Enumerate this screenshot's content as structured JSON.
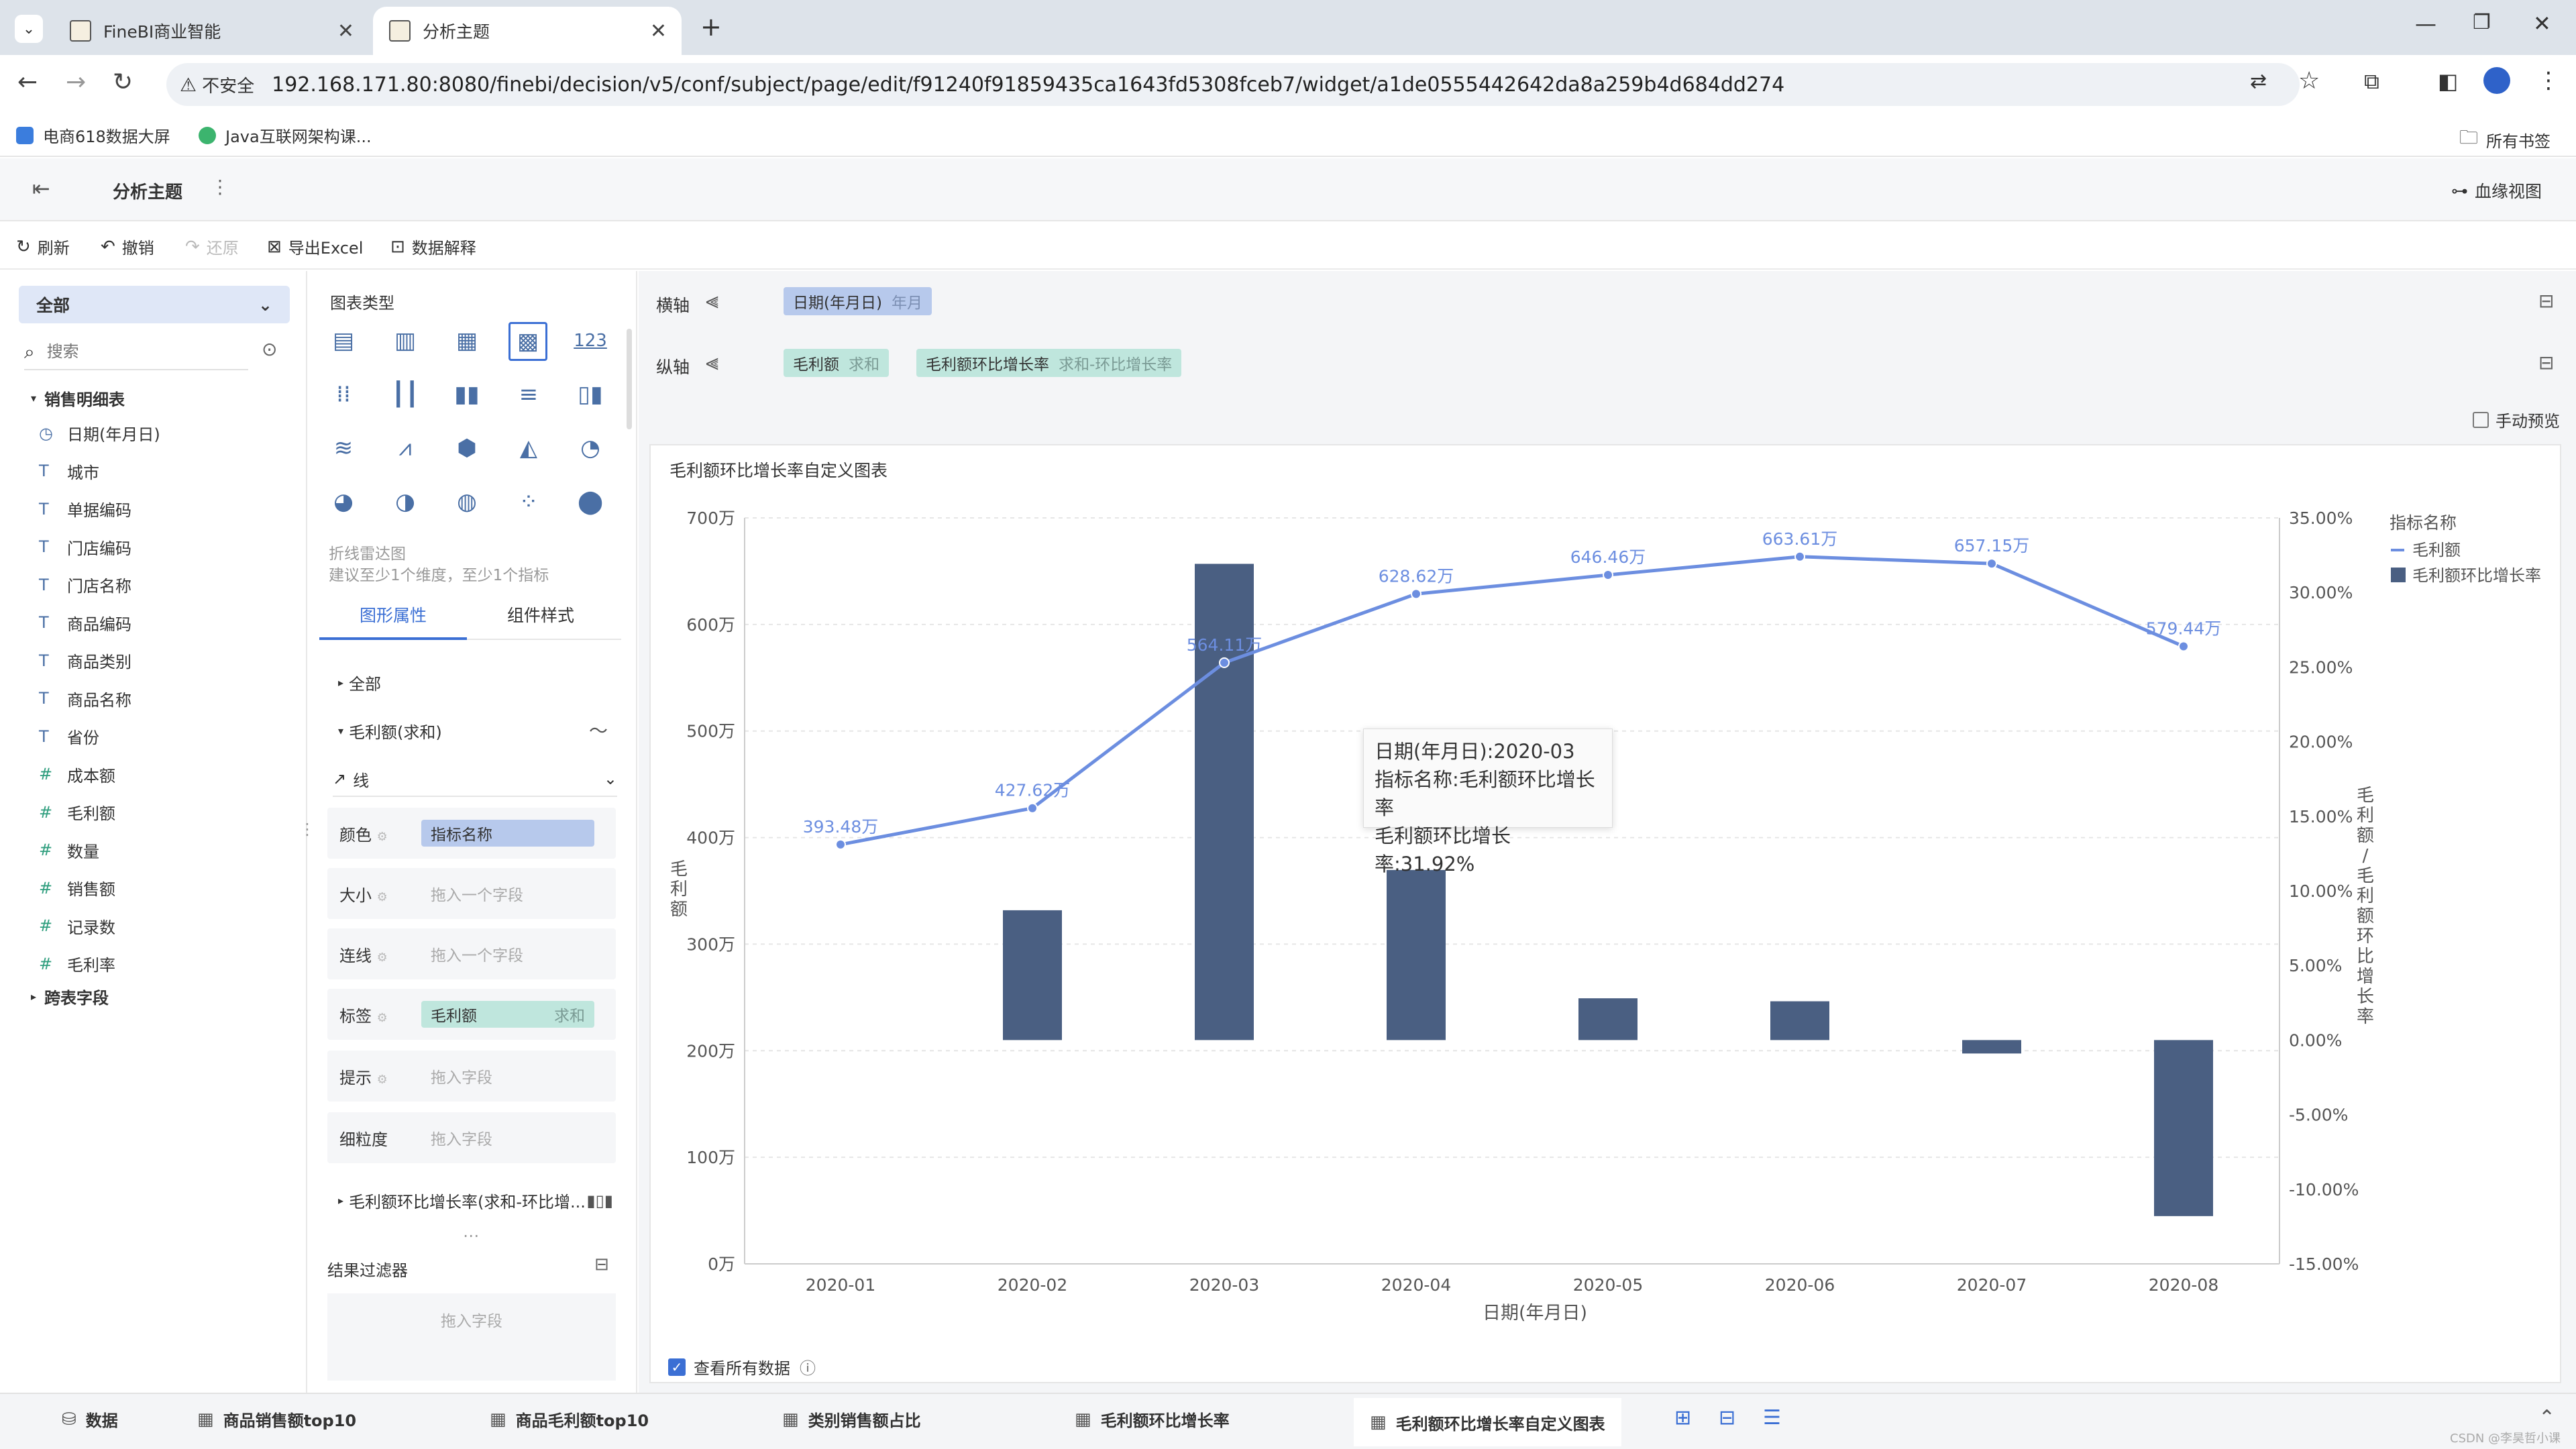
{
  "browser": {
    "tabs": [
      {
        "title": "FineBI商业智能"
      },
      {
        "title": "分析主题"
      }
    ],
    "security_label": "不安全",
    "url": "192.168.171.80:8080/finebi/decision/v5/conf/subject/page/edit/f91240f91859435ca1643fd5308fceb7/widget/a1de0555442642da8a259b4d684dd274",
    "bookmarks": [
      "电商618数据大屏",
      "Java互联网架构课..."
    ],
    "all_bookmarks": "所有书签"
  },
  "app": {
    "title": "分析主题",
    "lineage_view": "血缘视图"
  },
  "toolbar": {
    "refresh": "刷新",
    "undo": "撤销",
    "redo": "还原",
    "export_excel": "导出Excel",
    "data_explain": "数据解释"
  },
  "left": {
    "dropdown": "全部",
    "search_placeholder": "搜索",
    "table_name": "销售明细表",
    "fields": [
      {
        "name": "日期(年月日)",
        "type": "date"
      },
      {
        "name": "城市",
        "type": "text"
      },
      {
        "name": "单据编码",
        "type": "text"
      },
      {
        "name": "门店编码",
        "type": "text"
      },
      {
        "name": "门店名称",
        "type": "text"
      },
      {
        "name": "商品编码",
        "type": "text"
      },
      {
        "name": "商品类别",
        "type": "text"
      },
      {
        "name": "商品名称",
        "type": "text"
      },
      {
        "name": "省份",
        "type": "text"
      },
      {
        "name": "成本额",
        "type": "num"
      },
      {
        "name": "毛利额",
        "type": "num"
      },
      {
        "name": "数量",
        "type": "num"
      },
      {
        "name": "销售额",
        "type": "num"
      },
      {
        "name": "记录数",
        "type": "num"
      },
      {
        "name": "毛利率",
        "type": "num"
      }
    ],
    "cross_table": "跨表字段"
  },
  "middle": {
    "chart_type_label": "图表类型",
    "numeric_icon_label": "123",
    "hint_title": "折线雷达图",
    "hint_desc": "建议至少1个维度，至少1个指标",
    "tabs": [
      "图形属性",
      "组件样式"
    ],
    "all_label": "全部",
    "series1": "毛利额(求和)",
    "line_label": "线",
    "props": {
      "color": {
        "label": "颜色",
        "value": "指标名称"
      },
      "size": {
        "label": "大小",
        "placeholder": "拖入一个字段"
      },
      "connect": {
        "label": "连线",
        "placeholder": "拖入一个字段"
      },
      "label": {
        "label": "标签",
        "value": "毛利额",
        "agg": "求和"
      },
      "tip": {
        "label": "提示",
        "placeholder": "拖入字段"
      },
      "granularity": {
        "label": "细粒度",
        "placeholder": "拖入字段"
      }
    },
    "series2": "毛利额环比增长率(求和-环比增...",
    "filter_title": "结果过滤器",
    "filter_placeholder": "拖入字段"
  },
  "axes_config": {
    "x_label": "横轴",
    "x_field": "日期(年月日)",
    "x_field_sub": "年月",
    "y_label": "纵轴",
    "y_field1": "毛利额",
    "y_field1_sub": "求和",
    "y_field2": "毛利额环比增长率",
    "y_field2_sub": "求和-环比增长率",
    "manual_preview": "手动预览"
  },
  "chart_data": {
    "type": "bar",
    "title": "毛利额环比增长率自定义图表",
    "xlabel": "日期(年月日)",
    "ylabel": "毛利额",
    "y2label": "毛利额/毛利额环比增长率",
    "categories": [
      "2020-01",
      "2020-02",
      "2020-03",
      "2020-04",
      "2020-05",
      "2020-06",
      "2020-07",
      "2020-08"
    ],
    "ylim": [
      0,
      7000000
    ],
    "y_ticks": [
      "0万",
      "100万",
      "200万",
      "300万",
      "400万",
      "500万",
      "600万",
      "700万"
    ],
    "y2lim": [
      -15,
      35
    ],
    "y2_ticks": [
      "-15.00%",
      "-10.00%",
      "-5.00%",
      "0.00%",
      "5.00%",
      "10.00%",
      "15.00%",
      "20.00%",
      "25.00%",
      "30.00%",
      "35.00%"
    ],
    "legend_title": "指标名称",
    "series": [
      {
        "name": "毛利额",
        "kind": "line",
        "color": "#6c8ee0",
        "values": [
          3934800,
          4276200,
          5641100,
          6286200,
          6464600,
          6636100,
          6571500,
          5794400
        ],
        "labels": [
          "393.48万",
          "427.62万",
          "564.11万",
          "628.62万",
          "646.46万",
          "663.61万",
          "657.15万",
          "579.44万"
        ]
      },
      {
        "name": "毛利额环比增长率",
        "kind": "bar",
        "color": "#4a5f82",
        "values": [
          null,
          8.7,
          31.92,
          11.4,
          2.8,
          2.6,
          -0.9,
          -11.8
        ]
      }
    ],
    "legend_position": "top-right"
  },
  "tooltip": {
    "line1": "日期(年月日):2020-03",
    "line2": "指标名称:毛利额环比增长率",
    "line3": "毛利额环比增长率:31.92%"
  },
  "view_all": "查看所有数据",
  "bottom_tabs": [
    "数据",
    "商品销售额top10",
    "商品毛利额top10",
    "类别销售额占比",
    "毛利额环比增长率",
    "毛利额环比增长率自定义图表"
  ],
  "watermark": "CSDN @李昊哲小课"
}
